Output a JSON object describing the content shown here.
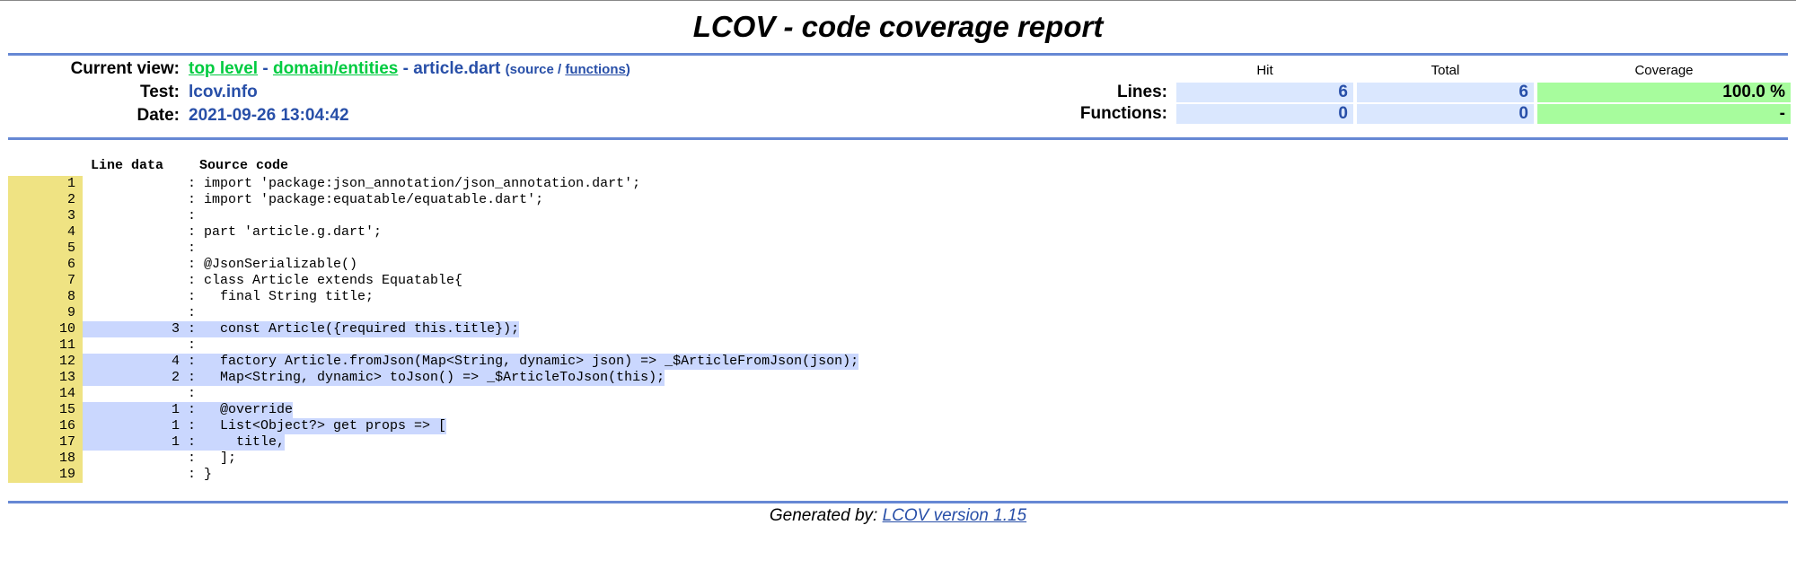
{
  "page_title": "LCOV - code coverage report",
  "header": {
    "current_view_label": "Current view:",
    "crumb_top": "top level",
    "sep1": " - ",
    "crumb_dir": "domain/entities",
    "sep2": " - ",
    "crumb_file": "article.dart",
    "source_label": "(source / ",
    "functions_link": "functions",
    "close_paren": ")",
    "test_label": "Test:",
    "test_value": "lcov.info",
    "date_label": "Date:",
    "date_value": "2021-09-26 13:04:42"
  },
  "stats": {
    "col_hit": "Hit",
    "col_total": "Total",
    "col_coverage": "Coverage",
    "lines_label": "Lines:",
    "lines_hit": "6",
    "lines_total": "6",
    "lines_coverage": "100.0 %",
    "functions_label": "Functions:",
    "functions_hit": "0",
    "functions_total": "0",
    "functions_coverage": "-"
  },
  "code": {
    "col_line_data": "Line data",
    "col_source": "Source code",
    "lines": [
      {
        "n": "1",
        "hits": "",
        "src": "import 'package:json_annotation/json_annotation.dart';"
      },
      {
        "n": "2",
        "hits": "",
        "src": "import 'package:equatable/equatable.dart';"
      },
      {
        "n": "3",
        "hits": "",
        "src": ""
      },
      {
        "n": "4",
        "hits": "",
        "src": "part 'article.g.dart';"
      },
      {
        "n": "5",
        "hits": "",
        "src": ""
      },
      {
        "n": "6",
        "hits": "",
        "src": "@JsonSerializable()"
      },
      {
        "n": "7",
        "hits": "",
        "src": "class Article extends Equatable{"
      },
      {
        "n": "8",
        "hits": "",
        "src": "  final String title;"
      },
      {
        "n": "9",
        "hits": "",
        "src": ""
      },
      {
        "n": "10",
        "hits": "3",
        "src": "  const Article({required this.title});"
      },
      {
        "n": "11",
        "hits": "",
        "src": ""
      },
      {
        "n": "12",
        "hits": "4",
        "src": "  factory Article.fromJson(Map<String, dynamic> json) => _$ArticleFromJson(json);"
      },
      {
        "n": "13",
        "hits": "2",
        "src": "  Map<String, dynamic> toJson() => _$ArticleToJson(this);"
      },
      {
        "n": "14",
        "hits": "",
        "src": ""
      },
      {
        "n": "15",
        "hits": "1",
        "src": "  @override"
      },
      {
        "n": "16",
        "hits": "1",
        "src": "  List<Object?> get props => ["
      },
      {
        "n": "17",
        "hits": "1",
        "src": "    title,"
      },
      {
        "n": "18",
        "hits": "",
        "src": "  ];"
      },
      {
        "n": "19",
        "hits": "",
        "src": "}"
      }
    ]
  },
  "footer": {
    "generated_by": "Generated by: ",
    "version_link": "LCOV version 1.15"
  }
}
